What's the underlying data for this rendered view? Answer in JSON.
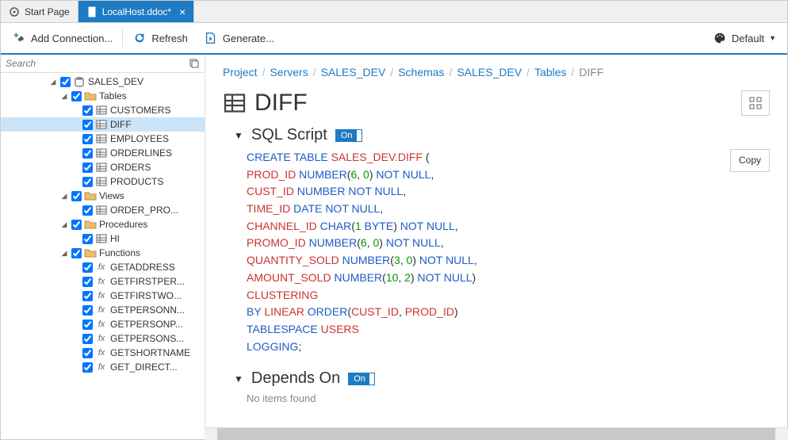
{
  "tabs": [
    {
      "label": "Start Page",
      "active": false
    },
    {
      "label": "LocalHost.ddoc*",
      "active": true
    }
  ],
  "toolbar": {
    "add_connection": "Add Connection...",
    "refresh": "Refresh",
    "generate": "Generate...",
    "theme": "Default"
  },
  "sidebar": {
    "search_placeholder": "Search",
    "tree": {
      "root": "SALES_DEV",
      "groups": [
        {
          "label": "Tables",
          "items": [
            "CUSTOMERS",
            "DIFF",
            "EMPLOYEES",
            "ORDERLINES",
            "ORDERS",
            "PRODUCTS"
          ],
          "selected": "DIFF"
        },
        {
          "label": "Views",
          "items": [
            "ORDER_PRO..."
          ]
        },
        {
          "label": "Procedures",
          "items": [
            "HI"
          ]
        },
        {
          "label": "Functions",
          "items": [
            "GETADDRESS",
            "GETFIRSTPER...",
            "GETFIRSTWO...",
            "GETPERSONN...",
            "GETPERSONP...",
            "GETPERSONS...",
            "GETSHORTNAME",
            "GET_DIRECT..."
          ]
        }
      ]
    }
  },
  "breadcrumb": [
    "Project",
    "Servers",
    "SALES_DEV",
    "Schemas",
    "SALES_DEV",
    "Tables",
    "DIFF"
  ],
  "page_title": "DIFF",
  "sections": {
    "sql": {
      "title": "SQL Script",
      "badge": "On",
      "copy": "Copy"
    },
    "depends": {
      "title": "Depends On",
      "badge": "On",
      "empty": "No items found"
    }
  },
  "sql_tokens": [
    [
      {
        "t": "kw",
        "v": "CREATE TABLE "
      },
      {
        "t": "obj",
        "v": "SALES_DEV.DIFF"
      },
      {
        "t": "",
        "v": " ("
      }
    ],
    [
      {
        "t": "",
        "v": "  "
      },
      {
        "t": "obj",
        "v": "PROD_ID"
      },
      {
        "t": "",
        "v": " "
      },
      {
        "t": "kw",
        "v": "NUMBER"
      },
      {
        "t": "",
        "v": "("
      },
      {
        "t": "num",
        "v": "6"
      },
      {
        "t": "",
        "v": ", "
      },
      {
        "t": "num",
        "v": "0"
      },
      {
        "t": "",
        "v": ") "
      },
      {
        "t": "kw",
        "v": "NOT NULL"
      },
      {
        "t": "",
        "v": ","
      }
    ],
    [
      {
        "t": "",
        "v": "  "
      },
      {
        "t": "obj",
        "v": "CUST_ID"
      },
      {
        "t": "",
        "v": " "
      },
      {
        "t": "kw",
        "v": "NUMBER NOT NULL"
      },
      {
        "t": "",
        "v": ","
      }
    ],
    [
      {
        "t": "",
        "v": "  "
      },
      {
        "t": "obj",
        "v": "TIME_ID"
      },
      {
        "t": "",
        "v": " "
      },
      {
        "t": "kw",
        "v": "DATE NOT NULL"
      },
      {
        "t": "",
        "v": ","
      }
    ],
    [
      {
        "t": "",
        "v": "  "
      },
      {
        "t": "obj",
        "v": "CHANNEL_ID"
      },
      {
        "t": "",
        "v": " "
      },
      {
        "t": "kw",
        "v": "CHAR"
      },
      {
        "t": "",
        "v": "("
      },
      {
        "t": "num",
        "v": "1"
      },
      {
        "t": "",
        "v": " "
      },
      {
        "t": "kw",
        "v": "BYTE"
      },
      {
        "t": "",
        "v": ") "
      },
      {
        "t": "kw",
        "v": "NOT NULL"
      },
      {
        "t": "",
        "v": ","
      }
    ],
    [
      {
        "t": "",
        "v": "  "
      },
      {
        "t": "obj",
        "v": "PROMO_ID"
      },
      {
        "t": "",
        "v": " "
      },
      {
        "t": "kw",
        "v": "NUMBER"
      },
      {
        "t": "",
        "v": "("
      },
      {
        "t": "num",
        "v": "6"
      },
      {
        "t": "",
        "v": ", "
      },
      {
        "t": "num",
        "v": "0"
      },
      {
        "t": "",
        "v": ") "
      },
      {
        "t": "kw",
        "v": "NOT NULL"
      },
      {
        "t": "",
        "v": ","
      }
    ],
    [
      {
        "t": "",
        "v": "  "
      },
      {
        "t": "obj",
        "v": "QUANTITY_SOLD"
      },
      {
        "t": "",
        "v": " "
      },
      {
        "t": "kw",
        "v": "NUMBER"
      },
      {
        "t": "",
        "v": "("
      },
      {
        "t": "num",
        "v": "3"
      },
      {
        "t": "",
        "v": ", "
      },
      {
        "t": "num",
        "v": "0"
      },
      {
        "t": "",
        "v": ") "
      },
      {
        "t": "kw",
        "v": "NOT NULL"
      },
      {
        "t": "",
        "v": ","
      }
    ],
    [
      {
        "t": "",
        "v": "  "
      },
      {
        "t": "obj",
        "v": "AMOUNT_SOLD"
      },
      {
        "t": "",
        "v": " "
      },
      {
        "t": "kw",
        "v": "NUMBER"
      },
      {
        "t": "",
        "v": "("
      },
      {
        "t": "num",
        "v": "10"
      },
      {
        "t": "",
        "v": ", "
      },
      {
        "t": "num",
        "v": "2"
      },
      {
        "t": "",
        "v": ") "
      },
      {
        "t": "kw",
        "v": "NOT NULL"
      },
      {
        "t": "",
        "v": ")"
      }
    ],
    [
      {
        "t": "obj",
        "v": "CLUSTERING"
      }
    ],
    [
      {
        "t": "kw",
        "v": "BY"
      },
      {
        "t": "",
        "v": " "
      },
      {
        "t": "obj",
        "v": "LINEAR"
      },
      {
        "t": "",
        "v": " "
      },
      {
        "t": "kw",
        "v": "ORDER"
      },
      {
        "t": "",
        "v": "("
      },
      {
        "t": "obj",
        "v": "CUST_ID"
      },
      {
        "t": "",
        "v": ", "
      },
      {
        "t": "obj",
        "v": "PROD_ID"
      },
      {
        "t": "",
        "v": ")"
      }
    ],
    [
      {
        "t": "kw",
        "v": "TABLESPACE"
      },
      {
        "t": "",
        "v": " "
      },
      {
        "t": "obj",
        "v": "USERS"
      }
    ],
    [
      {
        "t": "kw",
        "v": "LOGGING"
      },
      {
        "t": "",
        "v": ";"
      }
    ]
  ]
}
